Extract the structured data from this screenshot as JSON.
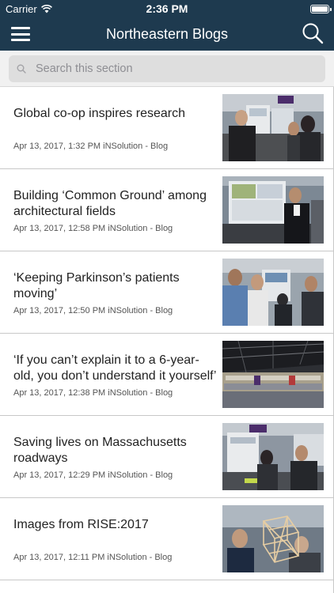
{
  "status_bar": {
    "carrier": "Carrier",
    "time": "2:36 PM"
  },
  "nav": {
    "title": "Northeastern Blogs"
  },
  "search": {
    "placeholder": "Search this section"
  },
  "articles": [
    {
      "title": "Global co-op inspires research",
      "meta": "Apr 13, 2017, 1:32 PM iNSolution - Blog",
      "image": "poster-session-photo"
    },
    {
      "title": "Building ‘Common Ground’ among architectural fields",
      "meta": "Apr 13, 2017, 12:58 PM iNSolution - Blog",
      "image": "presenter-at-poster-photo"
    },
    {
      "title": "‘Keeping Parkinson’s patients moving’",
      "meta": "Apr 13, 2017, 12:50 PM iNSolution - Blog",
      "image": "students-group-photo"
    },
    {
      "title": "‘If you can’t explain it to a 6-year-old, you don’t understand it yourself’",
      "meta": "Apr 13, 2017, 12:38 PM iNSolution - Blog",
      "image": "arena-overview-photo"
    },
    {
      "title": "Saving lives on Massachusetts roadways",
      "meta": "Apr 13, 2017, 12:29 PM iNSolution - Blog",
      "image": "research-expo-photo"
    },
    {
      "title": "Images from RISE:2017",
      "meta": "Apr 13, 2017, 12:11 PM iNSolution - Blog",
      "image": "model-structure-photo"
    }
  ]
}
